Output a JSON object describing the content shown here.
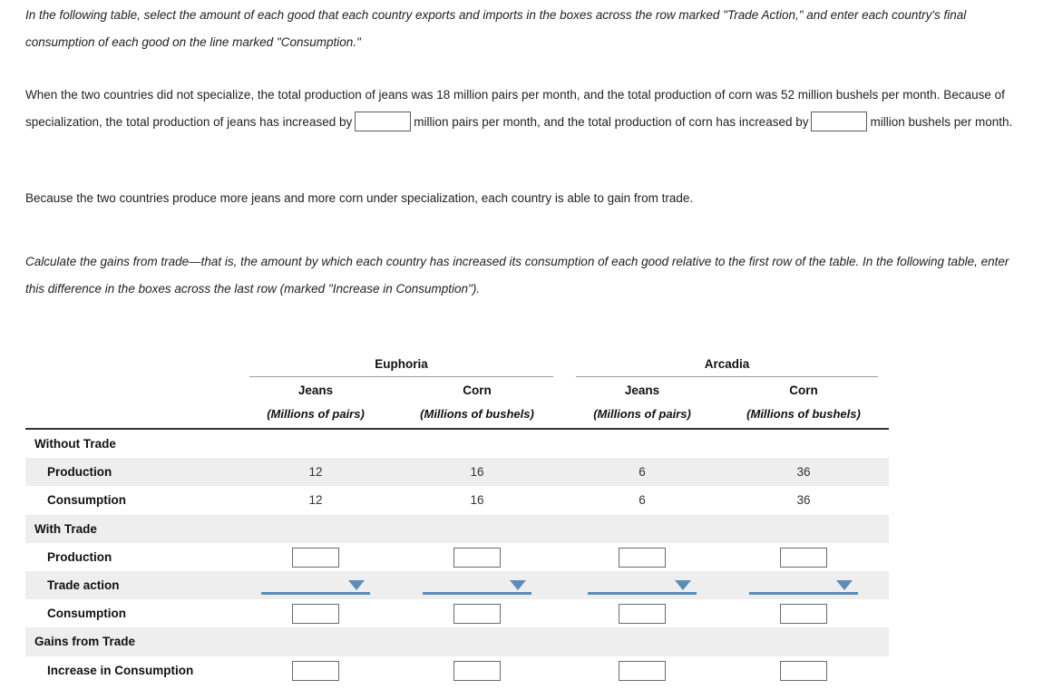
{
  "instructions": {
    "paragraph_1": "In the following table, select the amount of each good that each country exports and imports in the boxes across the row marked \"Trade Action,\" and enter each country's final consumption of each good on the line marked \"Consumption.\"",
    "paragraph_2_part_1": "When the two countries did not specialize, the total production of jeans was 18 million pairs per month, and the total production of corn was 52 million bushels per month. Because of specialization, the total production of jeans has increased by",
    "paragraph_2_part_2": "million pairs per month, and the total production of corn has increased by",
    "paragraph_2_part_3": "million bushels per month.",
    "paragraph_3": "Because the two countries produce more jeans and more corn under specialization, each country is able to gain from trade.",
    "paragraph_4": "Calculate the gains from trade—that is, the amount by which each country has increased its consumption of each good relative to the first row of the table. In the following table, enter this difference in the boxes across the last row (marked \"Increase in Consumption\")."
  },
  "inline_inputs": {
    "jeans_increase": {
      "value": "",
      "placeholder": ""
    },
    "corn_increase": {
      "value": "",
      "placeholder": ""
    }
  },
  "table": {
    "country_groups": [
      {
        "name": "Euphoria"
      },
      {
        "name": "Arcadia"
      }
    ],
    "columns": [
      {
        "good": "Jeans",
        "unit": "(Millions of pairs)"
      },
      {
        "good": "Corn",
        "unit": "(Millions of bushels)"
      },
      {
        "good": "Jeans",
        "unit": "(Millions of pairs)"
      },
      {
        "good": "Corn",
        "unit": "(Millions of bushels)"
      }
    ],
    "rows": [
      {
        "label": "Without Trade",
        "type": "section",
        "indent": false,
        "shaded": false,
        "cells": [
          "",
          "",
          "",
          ""
        ]
      },
      {
        "label": "Production",
        "type": "values",
        "indent": true,
        "shaded": true,
        "cells": [
          "12",
          "16",
          "6",
          "36"
        ]
      },
      {
        "label": "Consumption",
        "type": "values",
        "indent": true,
        "shaded": false,
        "cells": [
          "12",
          "16",
          "6",
          "36"
        ]
      },
      {
        "label": "With Trade",
        "type": "section",
        "indent": false,
        "shaded": true,
        "cells": [
          "",
          "",
          "",
          ""
        ]
      },
      {
        "label": "Production",
        "type": "inputs",
        "indent": true,
        "shaded": false,
        "cells": [
          "",
          "",
          "",
          ""
        ]
      },
      {
        "label": "Trade action",
        "type": "selects",
        "indent": true,
        "shaded": true,
        "cells": [
          "",
          "",
          "",
          ""
        ]
      },
      {
        "label": "Consumption",
        "type": "inputs",
        "indent": true,
        "shaded": false,
        "cells": [
          "",
          "",
          "",
          ""
        ]
      },
      {
        "label": "Gains from Trade",
        "type": "section",
        "indent": false,
        "shaded": true,
        "cells": [
          "",
          "",
          "",
          ""
        ]
      },
      {
        "label": "Increase in Consumption",
        "type": "inputs",
        "indent": true,
        "shaded": false,
        "cells": [
          "",
          "",
          "",
          ""
        ]
      }
    ]
  },
  "colors": {
    "row_shade": "#eeeeee",
    "rule_dark": "#333333",
    "rule_light": "#9a9a9a",
    "dropdown_accent": "#5b8db8",
    "input_border": "#6b6b6b",
    "text": "#111111"
  },
  "icons": {
    "dropdown_caret": "chevron-down-icon"
  }
}
